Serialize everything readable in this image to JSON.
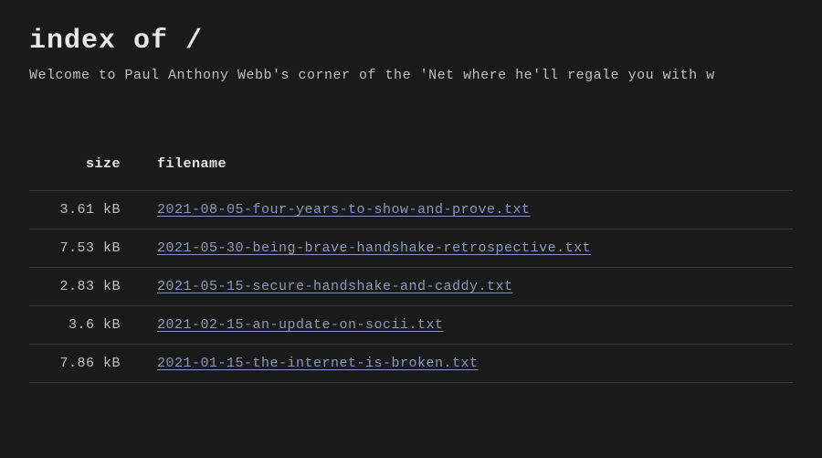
{
  "header": {
    "title": "index of /",
    "welcome": "Welcome to Paul Anthony Webb's corner of the 'Net where he'll regale you with w"
  },
  "table": {
    "columns": {
      "size": "size",
      "filename": "filename"
    },
    "rows": [
      {
        "size": "3.61 kB",
        "filename": "2021-08-05-four-years-to-show-and-prove.txt"
      },
      {
        "size": "7.53 kB",
        "filename": "2021-05-30-being-brave-handshake-retrospective.txt"
      },
      {
        "size": "2.83 kB",
        "filename": "2021-05-15-secure-handshake-and-caddy.txt"
      },
      {
        "size": "3.6 kB",
        "filename": "2021-02-15-an-update-on-socii.txt"
      },
      {
        "size": "7.86 kB",
        "filename": "2021-01-15-the-internet-is-broken.txt"
      }
    ]
  }
}
